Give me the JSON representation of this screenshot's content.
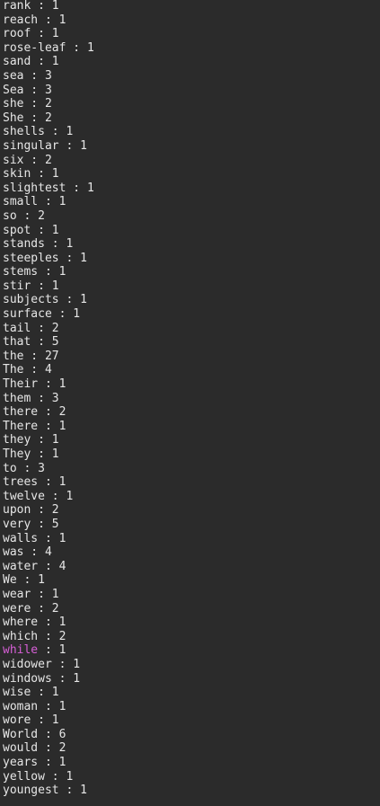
{
  "terminal": {
    "background": "#2b2b2b",
    "text_color": "#e6e6e6",
    "highlight_color": "#d75fd7",
    "separator": " : ",
    "lines": [
      {
        "word": "rank",
        "count": "1"
      },
      {
        "word": "reach",
        "count": "1"
      },
      {
        "word": "roof",
        "count": "1"
      },
      {
        "word": "rose-leaf",
        "count": "1"
      },
      {
        "word": "sand",
        "count": "1"
      },
      {
        "word": "sea",
        "count": "3"
      },
      {
        "word": "Sea",
        "count": "3"
      },
      {
        "word": "she",
        "count": "2"
      },
      {
        "word": "She",
        "count": "2"
      },
      {
        "word": "shells",
        "count": "1"
      },
      {
        "word": "singular",
        "count": "1"
      },
      {
        "word": "six",
        "count": "2"
      },
      {
        "word": "skin",
        "count": "1"
      },
      {
        "word": "slightest",
        "count": "1"
      },
      {
        "word": "small",
        "count": "1"
      },
      {
        "word": "so",
        "count": "2"
      },
      {
        "word": "spot",
        "count": "1"
      },
      {
        "word": "stands",
        "count": "1"
      },
      {
        "word": "steeples",
        "count": "1"
      },
      {
        "word": "stems",
        "count": "1"
      },
      {
        "word": "stir",
        "count": "1"
      },
      {
        "word": "subjects",
        "count": "1"
      },
      {
        "word": "surface",
        "count": "1"
      },
      {
        "word": "tail",
        "count": "2"
      },
      {
        "word": "that",
        "count": "5"
      },
      {
        "word": "the",
        "count": "27"
      },
      {
        "word": "The",
        "count": "4"
      },
      {
        "word": "Their",
        "count": "1"
      },
      {
        "word": "them",
        "count": "3"
      },
      {
        "word": "there",
        "count": "2"
      },
      {
        "word": "There",
        "count": "1"
      },
      {
        "word": "they",
        "count": "1"
      },
      {
        "word": "They",
        "count": "1"
      },
      {
        "word": "to",
        "count": "3"
      },
      {
        "word": "trees",
        "count": "1"
      },
      {
        "word": "twelve",
        "count": "1"
      },
      {
        "word": "upon",
        "count": "2"
      },
      {
        "word": "very",
        "count": "5"
      },
      {
        "word": "walls",
        "count": "1"
      },
      {
        "word": "was",
        "count": "4"
      },
      {
        "word": "water",
        "count": "4"
      },
      {
        "word": "We",
        "count": "1"
      },
      {
        "word": "wear",
        "count": "1"
      },
      {
        "word": "were",
        "count": "2"
      },
      {
        "word": "where",
        "count": "1"
      },
      {
        "word": "which",
        "count": "2"
      },
      {
        "word": "while",
        "count": "1",
        "highlight": true
      },
      {
        "word": "widower",
        "count": "1"
      },
      {
        "word": "windows",
        "count": "1"
      },
      {
        "word": "wise",
        "count": "1"
      },
      {
        "word": "woman",
        "count": "1"
      },
      {
        "word": "wore",
        "count": "1"
      },
      {
        "word": "World",
        "count": "6"
      },
      {
        "word": "would",
        "count": "2"
      },
      {
        "word": "years",
        "count": "1"
      },
      {
        "word": "yellow",
        "count": "1"
      },
      {
        "word": "youngest",
        "count": "1"
      }
    ]
  }
}
